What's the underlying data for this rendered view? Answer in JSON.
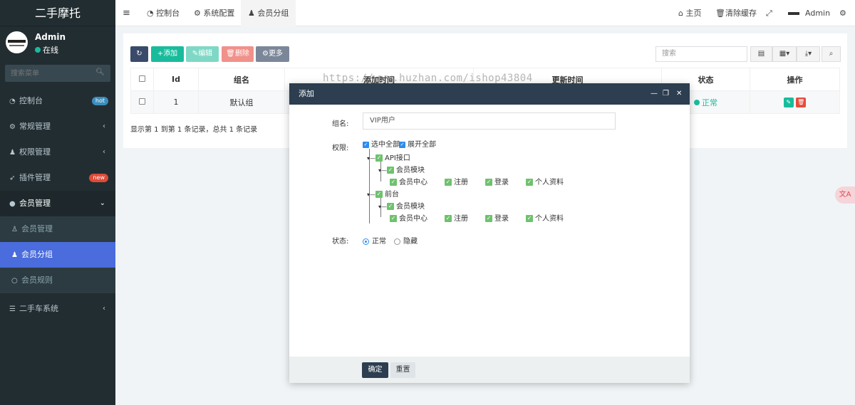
{
  "app": {
    "brand": "二手摩托"
  },
  "user": {
    "name": "Admin",
    "status": "在线"
  },
  "sidebar": {
    "search_placeholder": "搜索菜单",
    "items": [
      {
        "label": "控制台",
        "badge": "hot",
        "badge_color": "#3c8dbc"
      },
      {
        "label": "常规管理"
      },
      {
        "label": "权限管理"
      },
      {
        "label": "插件管理",
        "badge": "new",
        "badge_color": "#dd4b39"
      },
      {
        "label": "会员管理"
      },
      {
        "label": "会员管理"
      },
      {
        "label": "会员分组"
      },
      {
        "label": "会员规则"
      },
      {
        "label": "二手车系统"
      }
    ]
  },
  "navbar": {
    "tabs": [
      "控制台",
      "系统配置",
      "会员分组"
    ],
    "right": {
      "home": "主页",
      "clear_cache": "清除缓存",
      "admin": "Admin"
    }
  },
  "toolbar": {
    "add": "添加",
    "edit": "编辑",
    "delete": "删除",
    "more": "更多",
    "search_placeholder": "搜索"
  },
  "table": {
    "headers": [
      "Id",
      "组名",
      "添加时间",
      "更新时间",
      "状态",
      "操作"
    ],
    "rows": [
      {
        "id": "1",
        "name": "默认组",
        "status": "正常"
      }
    ],
    "summary": "显示第 1 到第 1 条记录，总共 1 条记录"
  },
  "watermark": "https://www.huzhan.com/ishop43804",
  "modal": {
    "title": "添加",
    "group_label": "组名:",
    "group_value": "VIP用户",
    "perm_label": "权限:",
    "select_all": "选中全部",
    "expand_all": "展开全部",
    "tree": [
      {
        "label": "API接口",
        "child": "会员模块",
        "leaves": [
          "会员中心",
          "注册",
          "登录",
          "个人资料"
        ]
      },
      {
        "label": "前台",
        "child": "会员模块",
        "leaves": [
          "会员中心",
          "注册",
          "登录",
          "个人资料"
        ]
      }
    ],
    "status_label": "状态:",
    "status_normal": "正常",
    "status_hidden": "隐藏",
    "confirm": "确定",
    "reset": "重置"
  },
  "colors": {
    "accent": "#4a6cdc",
    "success": "#18bc9c",
    "header": "#2c3e50"
  }
}
